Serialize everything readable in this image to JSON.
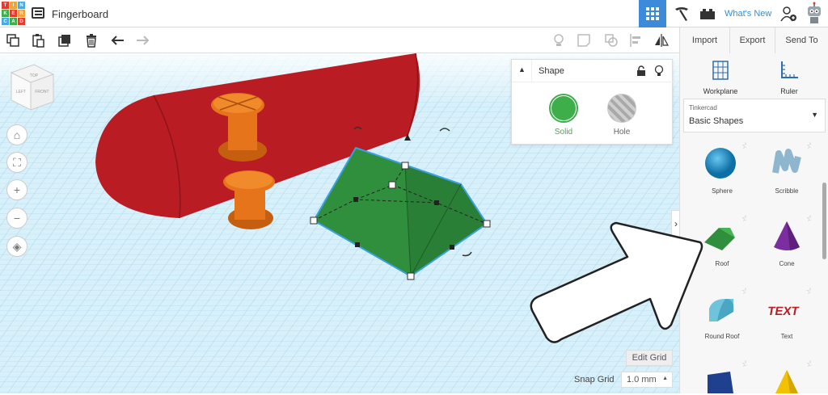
{
  "app": {
    "logo_letters": [
      "T",
      "I",
      "N",
      "K",
      "E",
      "R",
      "C",
      "A",
      "D"
    ],
    "logo_colors": [
      "#e03c31",
      "#f0a23b",
      "#4aa9df",
      "#3dae49",
      "#e03c31",
      "#f0a23b",
      "#4aa9df",
      "#3dae49",
      "#e03c31"
    ],
    "title": "Fingerboard"
  },
  "header": {
    "whats_new": "What's New",
    "import": "Import",
    "export": "Export",
    "send_to": "Send To"
  },
  "view_cube": {
    "top": "TOP",
    "left": "LEFT",
    "front": "FRONT"
  },
  "shape_panel": {
    "title": "Shape",
    "solid": "Solid",
    "hole": "Hole"
  },
  "sidebar": {
    "workplane": "Workplane",
    "ruler": "Ruler",
    "library_source": "Tinkercad",
    "library_name": "Basic Shapes",
    "shapes": [
      "Sphere",
      "Scribble",
      "Roof",
      "Cone",
      "Round Roof",
      "Text"
    ],
    "text_sample": "TEXT"
  },
  "bottom": {
    "edit_grid": "Edit Grid",
    "snap_grid_label": "Snap Grid",
    "snap_grid_value": "1.0 mm"
  },
  "colors": {
    "accent": "#3c8ad9",
    "solid": "#3dae49",
    "board": "#b91c22",
    "truck": "#e6741a",
    "roof": "#2f8f3c",
    "grid_bg": "#d8f0fa",
    "grid_line": "#a9d6ec"
  }
}
